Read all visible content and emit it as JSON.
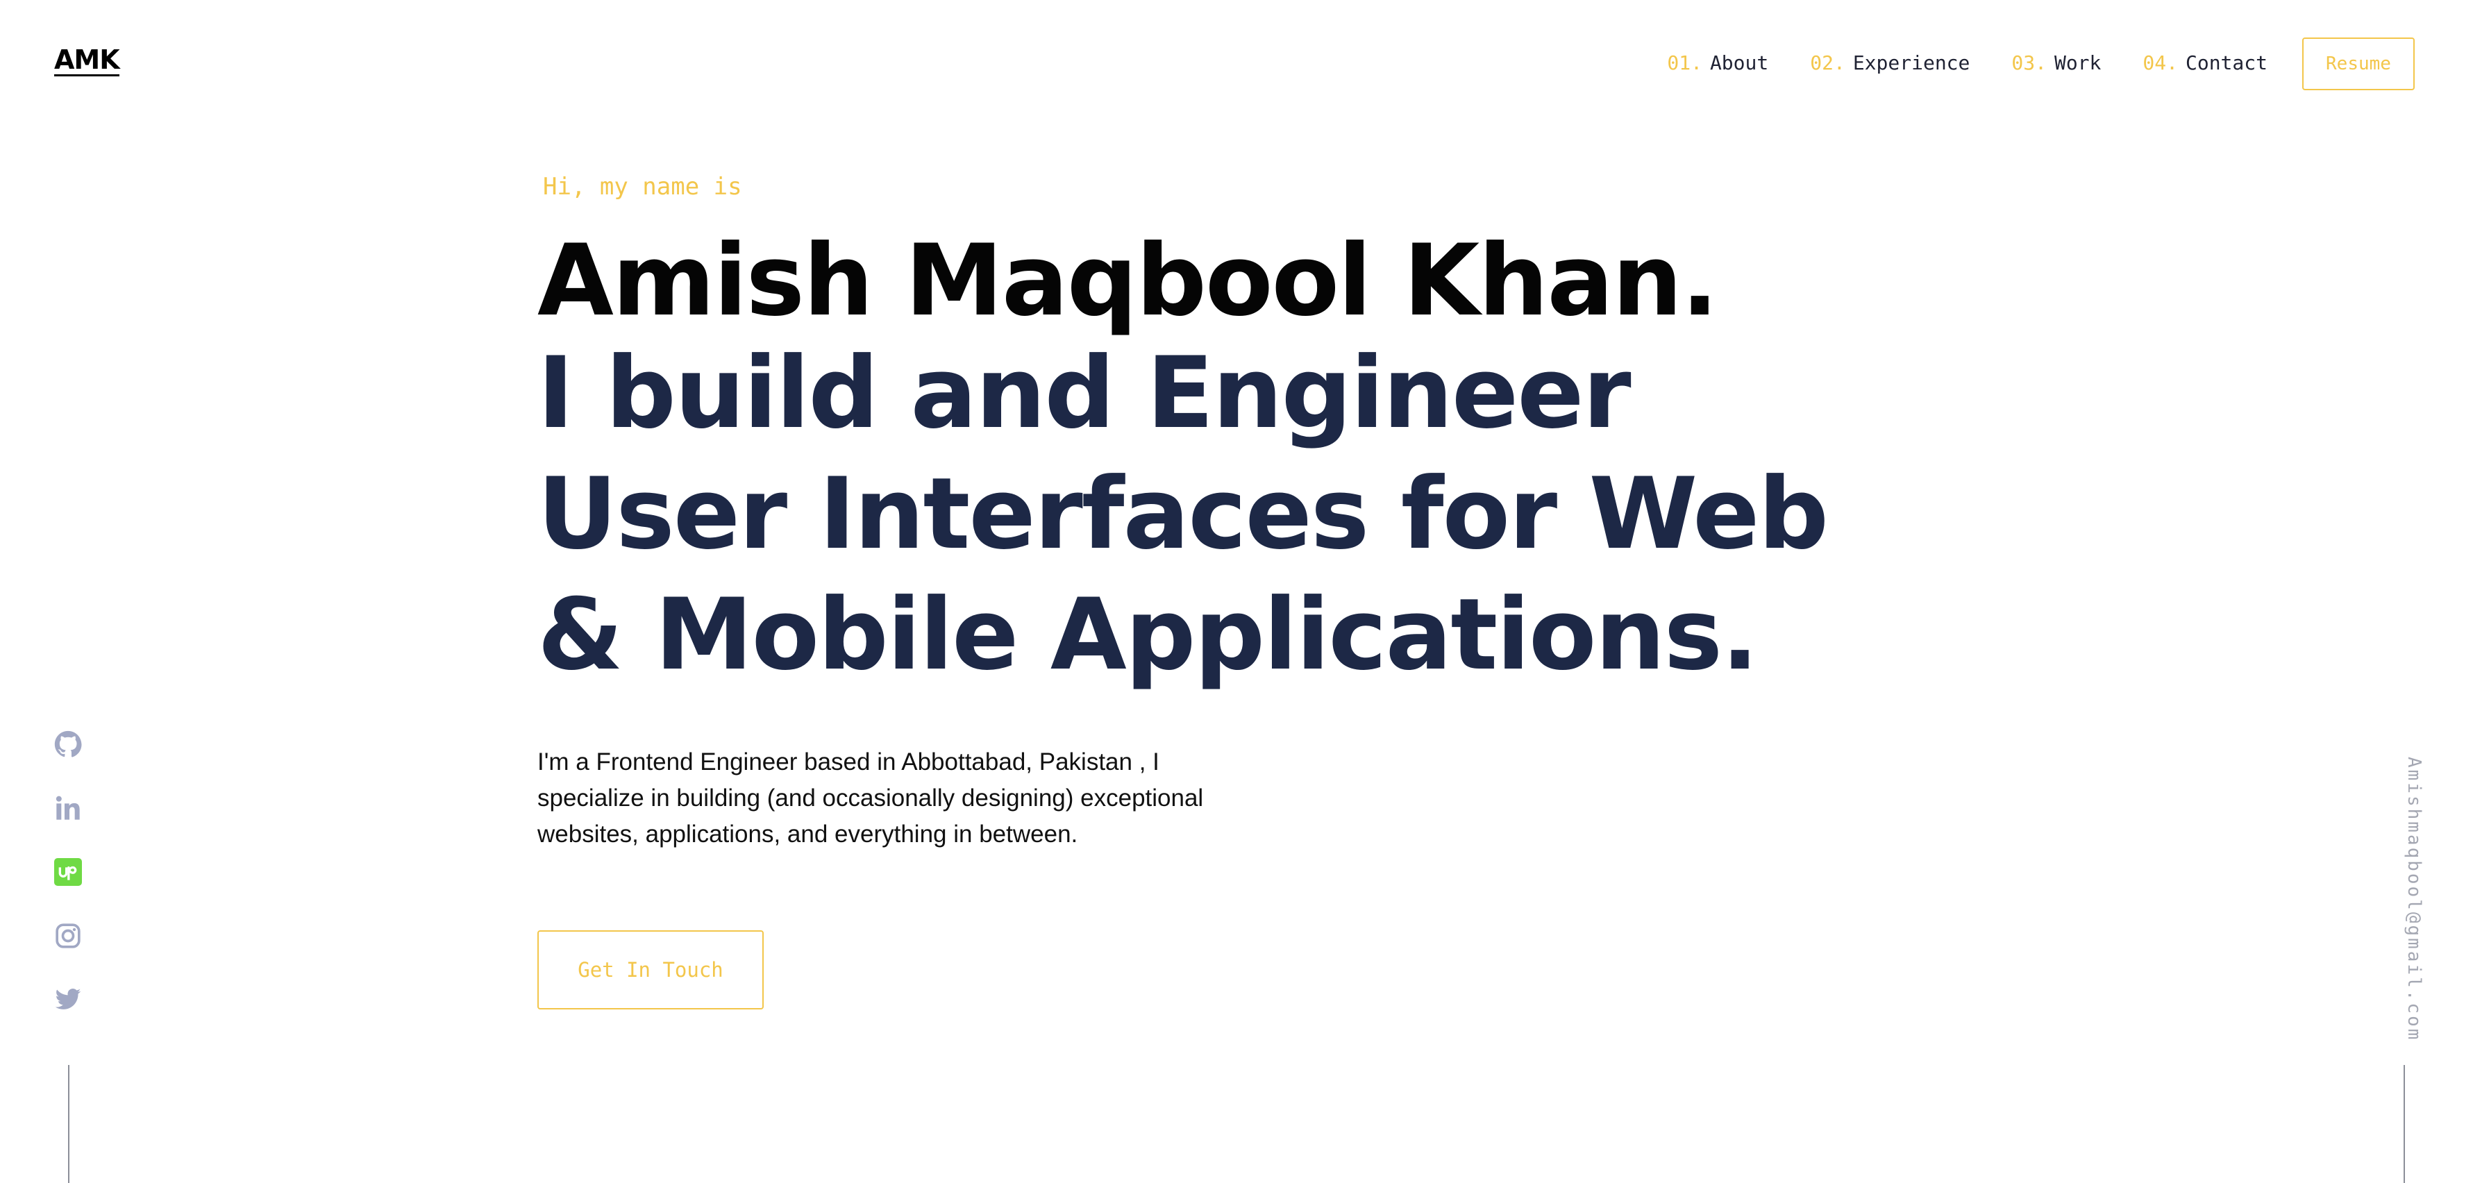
{
  "header": {
    "logo": "AMK",
    "nav": [
      {
        "num": "01.",
        "label": "About"
      },
      {
        "num": "02.",
        "label": "Experience"
      },
      {
        "num": "03.",
        "label": "Work"
      },
      {
        "num": "04.",
        "label": "Contact"
      }
    ],
    "resume_label": "Resume"
  },
  "hero": {
    "greeting": "Hi, my name is",
    "name": "Amish Maqbool Khan.",
    "headline": "I build and Engineer User Interfaces for Web & Mobile Applications.",
    "description": "I'm a Frontend Engineer based in Abbottabad, Pakistan , I specialize in building (and occasionally designing) exceptional websites, applications, and everything in between.",
    "cta_label": "Get In Touch"
  },
  "social": {
    "icons": [
      "github-icon",
      "linkedin-icon",
      "upwork-icon",
      "instagram-icon",
      "twitter-icon"
    ]
  },
  "sidebar": {
    "email": "Amishmaqbool@gmail.com"
  },
  "colors": {
    "accent": "#f3c64b",
    "navy": "#1d2846",
    "social_grey": "#a1a8c4",
    "upwork_green": "#6fda44"
  }
}
